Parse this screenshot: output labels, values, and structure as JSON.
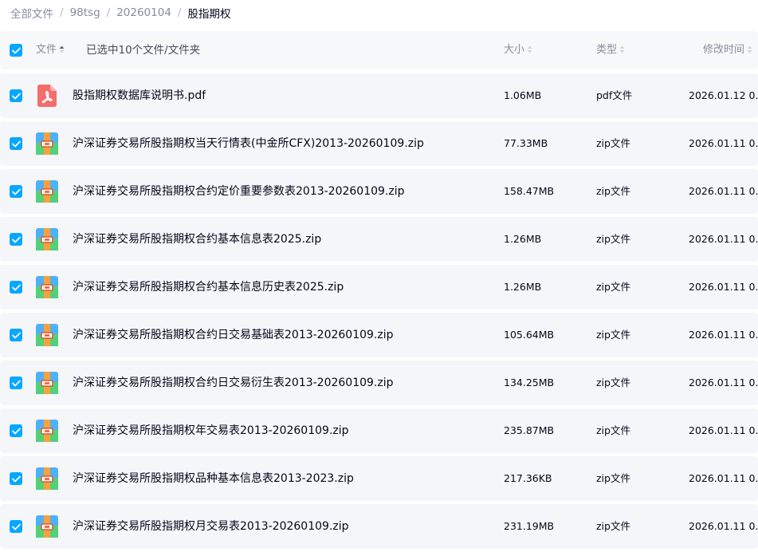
{
  "breadcrumb": {
    "items": [
      {
        "label": "全部文件"
      },
      {
        "label": "98tsg"
      },
      {
        "label": "20260104"
      }
    ],
    "current": "股指期权",
    "separator": "/"
  },
  "header": {
    "name_label": "文件",
    "selected_text": "已选中10个文件/文件夹",
    "size_label": "大小",
    "type_label": "类型",
    "mtime_label": "修改时间"
  },
  "colors": {
    "accent": "#06a7ff",
    "pdf_icon": "#f46c6c"
  },
  "files": [
    {
      "icon": "pdf-file-icon",
      "name": "股指期权数据库说明书.pdf",
      "size": "1.06MB",
      "type": "pdf文件",
      "date": "2026.01.12 0..."
    },
    {
      "icon": "zip-file-icon",
      "name": "沪深证券交易所股指期权当天行情表(中金所CFX)2013-20260109.zip",
      "size": "77.33MB",
      "type": "zip文件",
      "date": "2026.01.11 0..."
    },
    {
      "icon": "zip-file-icon",
      "name": "沪深证券交易所股指期权合约定价重要参数表2013-20260109.zip",
      "size": "158.47MB",
      "type": "zip文件",
      "date": "2026.01.11 0..."
    },
    {
      "icon": "zip-file-icon",
      "name": "沪深证券交易所股指期权合约基本信息表2025.zip",
      "size": "1.26MB",
      "type": "zip文件",
      "date": "2026.01.11 0..."
    },
    {
      "icon": "zip-file-icon",
      "name": "沪深证券交易所股指期权合约基本信息历史表2025.zip",
      "size": "1.26MB",
      "type": "zip文件",
      "date": "2026.01.11 0..."
    },
    {
      "icon": "zip-file-icon",
      "name": "沪深证券交易所股指期权合约日交易基础表2013-20260109.zip",
      "size": "105.64MB",
      "type": "zip文件",
      "date": "2026.01.11 0..."
    },
    {
      "icon": "zip-file-icon",
      "name": "沪深证券交易所股指期权合约日交易衍生表2013-20260109.zip",
      "size": "134.25MB",
      "type": "zip文件",
      "date": "2026.01.11 0..."
    },
    {
      "icon": "zip-file-icon",
      "name": "沪深证券交易所股指期权年交易表2013-20260109.zip",
      "size": "235.87MB",
      "type": "zip文件",
      "date": "2026.01.11 0..."
    },
    {
      "icon": "zip-file-icon",
      "name": "沪深证券交易所股指期权品种基本信息表2013-2023.zip",
      "size": "217.36KB",
      "type": "zip文件",
      "date": "2026.01.11 0..."
    },
    {
      "icon": "zip-file-icon",
      "name": "沪深证券交易所股指期权月交易表2013-20260109.zip",
      "size": "231.19MB",
      "type": "zip文件",
      "date": "2026.01.11 0..."
    }
  ]
}
